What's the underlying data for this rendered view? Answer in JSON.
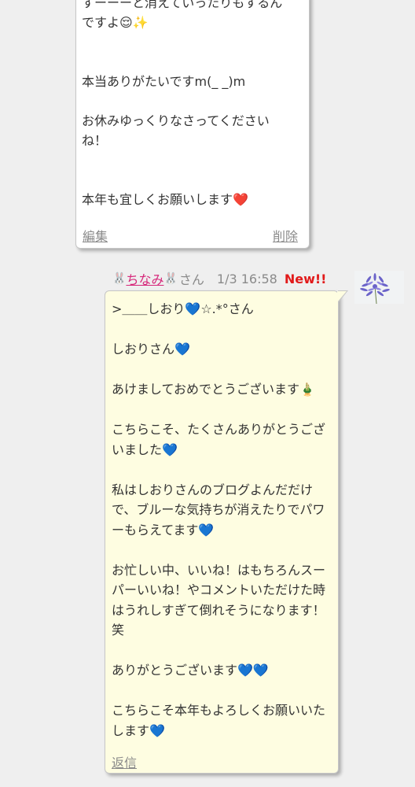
{
  "previous_comment": {
    "body": "すーーーと消えていったりもするんですよ😌✨\n\n\n本当ありがたいですm(_ _)m\n\nお休みゆっくりなさってくださいね！\n\n\n本年も宜しくお願いします❤️",
    "edit_label": "編集",
    "delete_label": "削除"
  },
  "comment": {
    "name_prefix": "🐰",
    "name": "ちなみ",
    "name_suffix_emoji": "🐰",
    "honorific": "さん",
    "date": "1/3 16:58",
    "new_badge": "New!!",
    "avatar_icon": "agapanthus-flower-icon",
    "body": ">＿＿しおり💙☆.*°さん\n\nしおりさん💙\n\nあけましておめでとうございます🎍\n\nこちらこそ、たくさんありがとうございました💙\n\n私はしおりさんのブログよんだだけで、ブルーな気持ちが消えたりでパワーもらえてます💙\n\nお忙しい中、いいね！はもちろんスーパーいいね！やコメントいただけた時はうれしすぎて倒れそうになります！笑\n\nありがとうございます💙💙\n\nこちらこそ本年もよろしくお願いいたします💙",
    "reply_label": "返信"
  },
  "colors": {
    "name_link": "#d6277a",
    "new_badge": "#e11a1a",
    "bubble_main_bg": "#fefde1",
    "bubble_prev_bg": "#ffffff",
    "page_bg": "#efefef"
  }
}
